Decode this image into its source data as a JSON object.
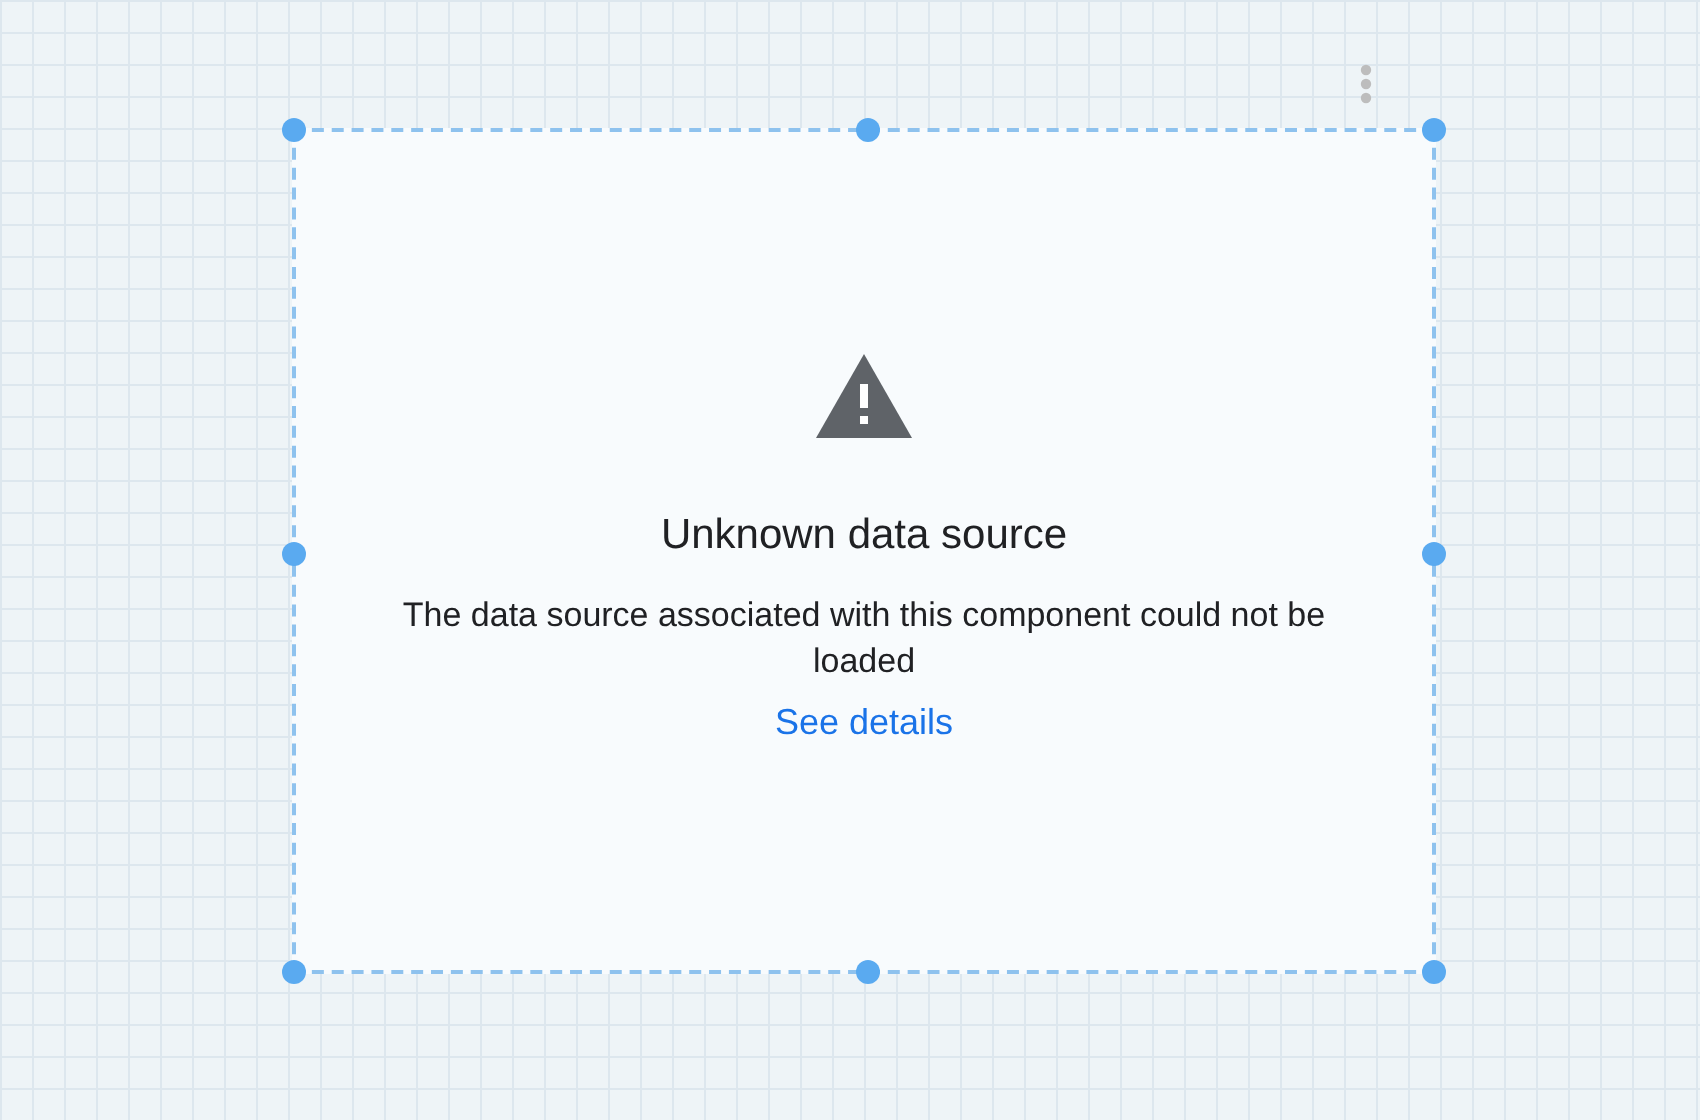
{
  "component": {
    "title": "Unknown data source",
    "message": "The data source associated with this component could not be loaded",
    "link": "See details"
  }
}
